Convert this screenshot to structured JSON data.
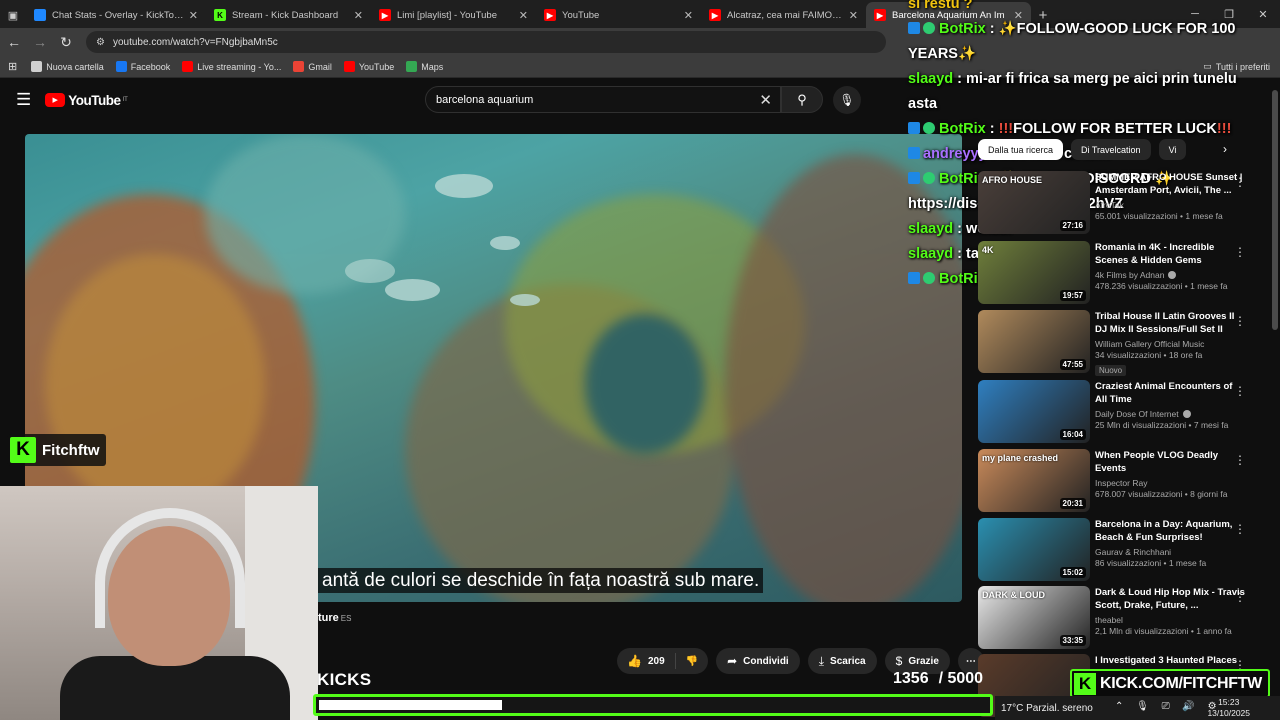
{
  "tabs": [
    {
      "label": "Chat Stats - Overlay - KickTools",
      "fav": "#1f88ff",
      "favtext": ""
    },
    {
      "label": "Stream - Kick Dashboard",
      "fav": "#53fc18",
      "favtext": "K"
    },
    {
      "label": "Limi [playlist] - YouTube",
      "fav": "#ff0000",
      "favtext": "▶"
    },
    {
      "label": "YouTube",
      "fav": "#ff0000",
      "favtext": "▶"
    },
    {
      "label": "Alcatraz, cea mai FAIMOASA Ins",
      "fav": "#ff0000",
      "favtext": "▶"
    },
    {
      "label": "Barcelona Aquarium An Im",
      "fav": "#ff0000",
      "favtext": "▶"
    }
  ],
  "toolbar": {
    "url": "youtube.com/watch?v=FNgbjbaMn5c"
  },
  "bookmarks": {
    "items": [
      {
        "label": "Nuova cartella",
        "color": "#d0d0d0"
      },
      {
        "label": "Facebook",
        "color": "#1877f2"
      },
      {
        "label": "Live streaming - Yo...",
        "color": "#ff0000"
      },
      {
        "label": "Gmail",
        "color": "#ea4335"
      },
      {
        "label": "YouTube",
        "color": "#ff0000"
      },
      {
        "label": "Maps",
        "color": "#34a853"
      }
    ],
    "all": "Tutti i preferiti"
  },
  "youtube": {
    "logo": "YouTube",
    "logo_sup": "IT",
    "search_value": "barcelona aquarium",
    "caption": "antă de culori se deschide în fața noastră sub mare.",
    "below_title": "ture",
    "below_title_tag": "ES",
    "likes": "209",
    "share": "Condividi",
    "download": "Scarica",
    "thanks": "Grazie",
    "chips": [
      "Dalla tua ricerca",
      "Di Travelcation",
      "Vi"
    ],
    "recs": [
      {
        "title": "SUMMER AFRO HOUSE Sunset | Amsterdam Port, Avicii, The ...",
        "channel": "AfroTek",
        "verified": false,
        "stats": "65.001 visualizzazioni • 1 mese fa",
        "dur": "27:16",
        "thumb": "#4a3f3a",
        "thumbtext": "AFRO HOUSE",
        "badge": ""
      },
      {
        "title": "Romania in 4K - Incredible Scenes & Hidden Gems",
        "channel": "4k Films by Adnan",
        "verified": true,
        "stats": "478.236 visualizzazioni • 1 mese fa",
        "dur": "19:57",
        "thumb": "#6f7f3b",
        "thumbtext": "4K",
        "badge": ""
      },
      {
        "title": "Tribal House II Latin Grooves II DJ Mix II Sessions/Full Set II",
        "channel": "William Gallery Official Music",
        "verified": false,
        "stats": "34 visualizzazioni • 18 ore fa",
        "dur": "47:55",
        "thumb": "#b08a5c",
        "thumbtext": "",
        "badge": "Nuovo"
      },
      {
        "title": "Craziest Animal Encounters of All Time",
        "channel": "Daily Dose Of Internet",
        "verified": true,
        "stats": "25 Mln di visualizzazioni • 7 mesi fa",
        "dur": "16:04",
        "thumb": "#2f7fc0",
        "thumbtext": "",
        "badge": ""
      },
      {
        "title": "When People VLOG Deadly Events",
        "channel": "Inspector Ray",
        "verified": false,
        "stats": "678.007 visualizzazioni • 8 giorni fa",
        "dur": "20:31",
        "thumb": "#c98a5a",
        "thumbtext": "my plane crashed",
        "badge": ""
      },
      {
        "title": "Barcelona in a Day: Aquarium, Beach & Fun Surprises!",
        "channel": "Gaurav & Rinchhani",
        "verified": false,
        "stats": "86 visualizzazioni • 1 mese fa",
        "dur": "15:02",
        "thumb": "#2a8fb0",
        "thumbtext": "",
        "badge": ""
      },
      {
        "title": "Dark & Loud Hip Hop Mix - Travis Scott, Drake, Future, ...",
        "channel": "theabel",
        "verified": false,
        "stats": "2,1 Mln di visualizzazioni • 1 anno fa",
        "dur": "33:35",
        "thumb": "#e8e8e8",
        "thumbtext": "DARK & LOUD",
        "badge": ""
      },
      {
        "title": "I Investigated 3 Haunted Places",
        "channel": "",
        "verified": false,
        "stats": "",
        "dur": "",
        "thumb": "#5a3b2a",
        "thumbtext": "",
        "badge": ""
      }
    ]
  },
  "chat": [
    {
      "html": "<span class='y'>si restu ?</span>"
    },
    {
      "html": "<span class='bi'></span><span class='bv'></span><span class='n'>BotRix</span> : ✨FOLLOW-GOOD LUCK FOR 100 YEARS✨"
    },
    {
      "html": "<span class='n'>slaayd</span> : mi-ar fi frica sa merg pe aici prin tunelu asta"
    },
    {
      "html": "<span class='bi'></span><span class='bv'></span><span class='n'>BotRix</span> : <span class='ex'>!!!</span>FOLLOW FOR BETTER LUCK<span class='ex'>!!!</span>"
    },
    {
      "html": "<span class='bi'></span><span class='p'>andreyyy</span> : tare nam ce zice"
    },
    {
      "html": "<span class='bi'></span><span class='bv'></span><span class='n'>BotRix</span> : ✨ SERVER DISCORD ✨ https://discord.gg/MnGJyf2hVZ"
    },
    {
      "html": "<span class='n'>slaayd</span> : woaaa"
    },
    {
      "html": "<span class='n'>slaayd</span> : tare rau"
    },
    {
      "html": "<span class='bi'></span><span class='bv'></span><span class='n'>BotRix</span> : ✨ YOU FAM"
    }
  ],
  "overlay": {
    "streamer": "Fitchftw",
    "kicks_label": "KICKS",
    "kicks_current": "1356",
    "kicks_goal": "/ 5000",
    "kicks_fraction": 0.2712,
    "kick_url": "KICK.COM/FITCHFTW"
  },
  "taskbar": {
    "weather": "17°C  Parzial. sereno",
    "time": "15:23",
    "date": "13/10/2025"
  },
  "colors": {
    "kick_green": "#53fc18",
    "yt_red": "#ff0000",
    "bg": "#0f0f0f"
  }
}
